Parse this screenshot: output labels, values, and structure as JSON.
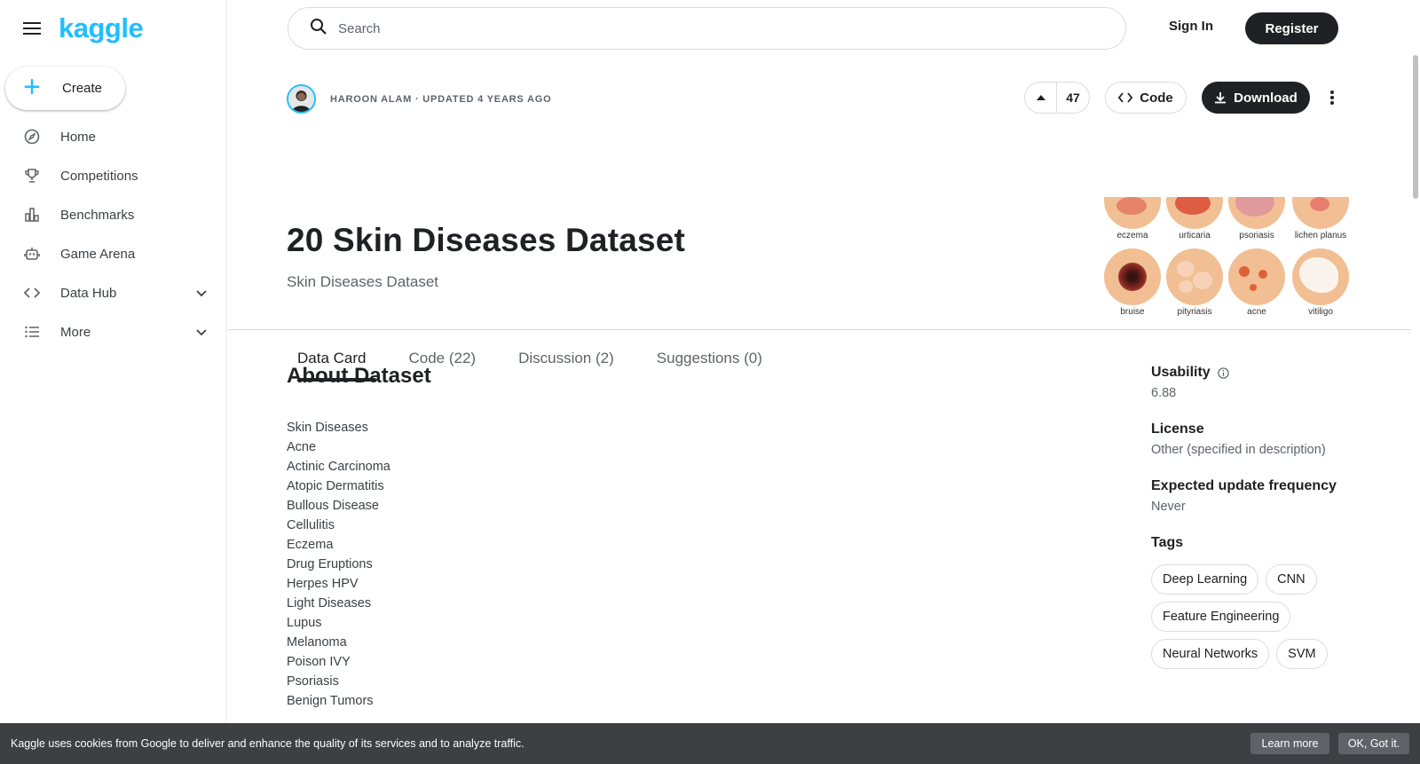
{
  "app": {
    "logo": "kaggle"
  },
  "sidebar": {
    "create_label": "Create",
    "items": [
      {
        "label": "Home",
        "icon": "compass-icon"
      },
      {
        "label": "Competitions",
        "icon": "trophy-icon"
      },
      {
        "label": "Benchmarks",
        "icon": "bar-chart-icon"
      },
      {
        "label": "Game Arena",
        "icon": "robot-icon"
      },
      {
        "label": "Data Hub",
        "icon": "code-icon"
      },
      {
        "label": "More",
        "icon": "list-icon"
      }
    ]
  },
  "topbar": {
    "search_placeholder": "Search",
    "signin_label": "Sign In",
    "register_label": "Register"
  },
  "dataset": {
    "byline": "HAROON ALAM · UPDATED 4 YEARS AGO",
    "upvotes": "47",
    "code_label": "Code",
    "download_label": "Download",
    "title": "20 Skin Diseases Dataset",
    "subtitle": "Skin Diseases Dataset",
    "thumbnail_captions": [
      "eczema",
      "urticaria",
      "psoriasis",
      "lichen planus",
      "bruise",
      "pityriasis",
      "acne",
      "vitiligo"
    ]
  },
  "tabs": [
    {
      "label": "Data Card",
      "active": true
    },
    {
      "label": "Code (22)",
      "active": false
    },
    {
      "label": "Discussion (2)",
      "active": false
    },
    {
      "label": "Suggestions (0)",
      "active": false
    }
  ],
  "about": {
    "heading": "About Dataset",
    "items": [
      "Skin Diseases",
      "Acne",
      "Actinic Carcinoma",
      "Atopic Dermatitis",
      "Bullous Disease",
      "Cellulitis",
      "Eczema",
      "Drug Eruptions",
      "Herpes HPV",
      "Light Diseases",
      "Lupus",
      "Melanoma",
      "Poison IVY",
      "Psoriasis",
      "Benign Tumors"
    ]
  },
  "metadata": {
    "usability_label": "Usability",
    "usability_value": "6.88",
    "license_label": "License",
    "license_value": "Other (specified in description)",
    "frequency_label": "Expected update frequency",
    "frequency_value": "Never",
    "tags_label": "Tags",
    "tags": [
      "Deep Learning",
      "CNN",
      "Feature Engineering",
      "Neural Networks",
      "SVM"
    ]
  },
  "cookie": {
    "text": "Kaggle uses cookies from Google to deliver and enhance the quality of its services and to analyze traffic.",
    "learn_more": "Learn more",
    "ok": "OK, Got it."
  },
  "colors": {
    "brand": "#20beff",
    "dark": "#202124",
    "muted": "#5f6368",
    "cookie_bg": "#3c4043"
  }
}
